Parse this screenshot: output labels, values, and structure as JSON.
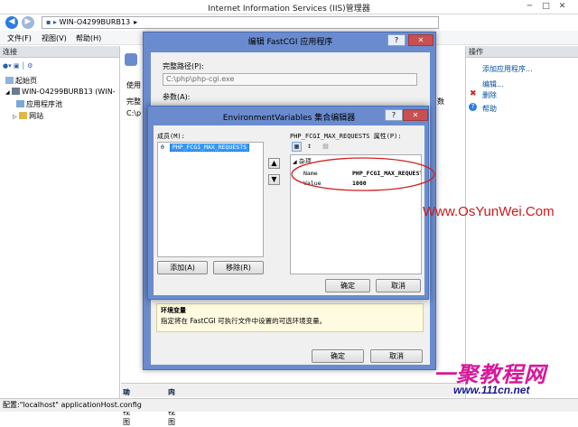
{
  "window": {
    "title": "Internet Information Services (IIS)管理器"
  },
  "address": {
    "path": "WIN-O4299BURB13"
  },
  "menu": {
    "items": [
      "文件(F)",
      "视图(V)",
      "帮助(H)"
    ]
  },
  "left_pane": {
    "header": "连接",
    "tree": [
      "起始页",
      "WIN-O4299BURB13 (WIN-",
      "应用程序池",
      "网站"
    ]
  },
  "center_pane": {
    "partial_texts": [
      "使用",
      "完整",
      "C:\\p",
      "数"
    ]
  },
  "right_pane": {
    "header": "操作",
    "actions": [
      "添加应用程序...",
      "编辑...",
      "删除",
      "帮助"
    ]
  },
  "fastcgi_dialog": {
    "title": "编辑 FastCGI 应用程序",
    "path_label": "完整路径(P):",
    "path_value": "C:\\php\\php-cgi.exe",
    "args_label": "参数(A):",
    "desc_title": "环境变量",
    "desc_text": "指定将在 FastCGI 可执行文件中设置的可选环境变量。",
    "ok": "确定",
    "cancel": "取消",
    "help_btn": "?",
    "close_btn": "✕"
  },
  "env_dialog": {
    "title": "EnvironmentVariables 集合编辑器",
    "members_label": "成员(M):",
    "member_index": "0",
    "member_name": "PHP_FCGI_MAX_REQUESTS",
    "props_label": "PHP_FCGI_MAX_REQUESTS 属性(P):",
    "category": "杂项",
    "prop_rows": [
      {
        "name": "Name",
        "value": "PHP_FCGI_MAX_REQUESTS"
      },
      {
        "name": "Value",
        "value": "1000"
      }
    ],
    "add": "添加(A)",
    "remove": "移除(R)",
    "ok": "确定",
    "cancel": "取消",
    "help_btn": "?",
    "close_btn": "✕"
  },
  "bottom_tabs": [
    "功能视图",
    "内容视图"
  ],
  "status": "配置:\"localhost\" applicationHost.config",
  "watermark": "Www.OsYunWei.Com",
  "logo": {
    "title": "一聚教程网",
    "url": "www.111cn.net"
  },
  "colors": {
    "highlight_ellipse": "#d42020",
    "dialog_frame": "#6a8ccf",
    "selection": "#3399ff"
  }
}
